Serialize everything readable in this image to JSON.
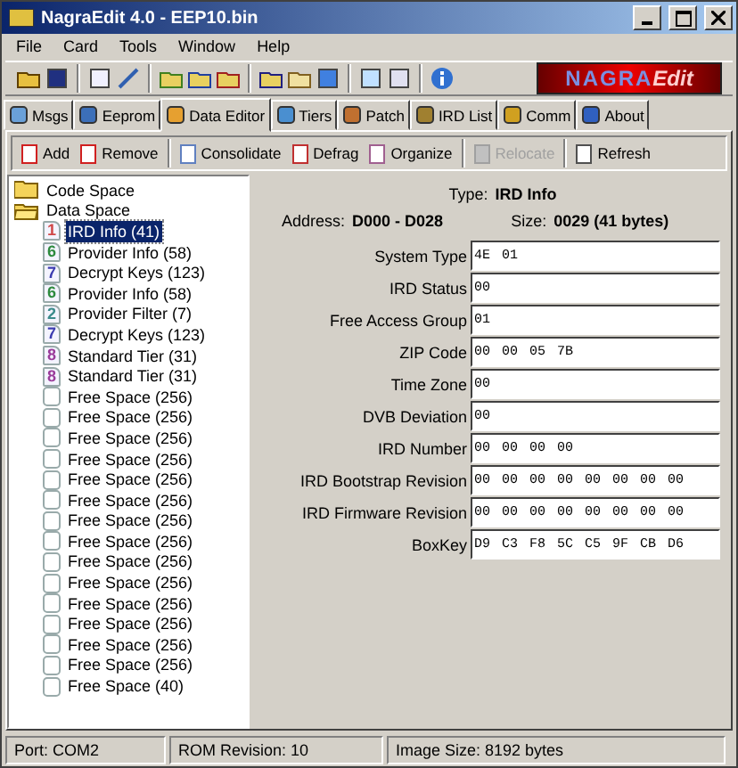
{
  "window": {
    "title": "NagraEdit 4.0 - EEP10.bin"
  },
  "menu": [
    "File",
    "Card",
    "Tools",
    "Window",
    "Help"
  ],
  "logo": {
    "main": "NAGRA",
    "accent": "Edit"
  },
  "tabs": [
    {
      "label": "Msgs",
      "selected": false
    },
    {
      "label": "Eeprom",
      "selected": false
    },
    {
      "label": "Data Editor",
      "selected": true
    },
    {
      "label": "Tiers",
      "selected": false
    },
    {
      "label": "Patch",
      "selected": false
    },
    {
      "label": "IRD List",
      "selected": false
    },
    {
      "label": "Comm",
      "selected": false
    },
    {
      "label": "About",
      "selected": false
    }
  ],
  "actions": [
    {
      "label": "Add",
      "disabled": false
    },
    {
      "label": "Remove",
      "disabled": false
    },
    {
      "label": "Consolidate",
      "disabled": false
    },
    {
      "label": "Defrag",
      "disabled": false
    },
    {
      "label": "Organize",
      "disabled": false
    },
    {
      "label": "Relocate",
      "disabled": true
    },
    {
      "label": "Refresh",
      "disabled": false
    }
  ],
  "tree": [
    {
      "label": "Code Space",
      "expanded": false
    },
    {
      "label": "Data Space",
      "expanded": true,
      "children": [
        {
          "label": "IRD Info (41)",
          "badge": "1",
          "color": "#d04848",
          "selected": true
        },
        {
          "label": "Provider Info (58)",
          "badge": "6",
          "color": "#2e8b3e",
          "selected": false
        },
        {
          "label": "Decrypt Keys (123)",
          "badge": "7",
          "color": "#3c3cb0",
          "selected": false
        },
        {
          "label": "Provider Info (58)",
          "badge": "6",
          "color": "#2e8b3e",
          "selected": false
        },
        {
          "label": "Provider Filter (7)",
          "badge": "2",
          "color": "#3c8c8c",
          "selected": false
        },
        {
          "label": "Decrypt Keys (123)",
          "badge": "7",
          "color": "#3c3cb0",
          "selected": false
        },
        {
          "label": "Standard Tier (31)",
          "badge": "8",
          "color": "#9a3c9a",
          "selected": false
        },
        {
          "label": "Standard Tier (31)",
          "badge": "8",
          "color": "#9a3c9a",
          "selected": false
        },
        {
          "label": "Free Space (256)",
          "selected": false
        },
        {
          "label": "Free Space (256)",
          "selected": false
        },
        {
          "label": "Free Space (256)",
          "selected": false
        },
        {
          "label": "Free Space (256)",
          "selected": false
        },
        {
          "label": "Free Space (256)",
          "selected": false
        },
        {
          "label": "Free Space (256)",
          "selected": false
        },
        {
          "label": "Free Space (256)",
          "selected": false
        },
        {
          "label": "Free Space (256)",
          "selected": false
        },
        {
          "label": "Free Space (256)",
          "selected": false
        },
        {
          "label": "Free Space (256)",
          "selected": false
        },
        {
          "label": "Free Space (256)",
          "selected": false
        },
        {
          "label": "Free Space (256)",
          "selected": false
        },
        {
          "label": "Free Space (256)",
          "selected": false
        },
        {
          "label": "Free Space (256)",
          "selected": false
        },
        {
          "label": "Free Space (40)",
          "selected": false
        }
      ]
    }
  ],
  "record": {
    "type_label": "Type:",
    "type": "IRD Info",
    "address_label": "Address:",
    "address": "D000 - D028",
    "size_label": "Size:",
    "size": "0029 (41 bytes)"
  },
  "fields": [
    {
      "label": "System Type",
      "value": "4E 01"
    },
    {
      "label": "IRD Status",
      "value": "00"
    },
    {
      "label": "Free Access Group",
      "value": "01"
    },
    {
      "label": "ZIP Code",
      "value": "00 00 05 7B"
    },
    {
      "label": "Time Zone",
      "value": "00"
    },
    {
      "label": "DVB Deviation",
      "value": "00"
    },
    {
      "label": "IRD Number",
      "value": "00 00 00 00"
    },
    {
      "label": "IRD Bootstrap Revision",
      "value": "00 00 00 00 00 00 00 00"
    },
    {
      "label": "IRD Firmware Revision",
      "value": "00 00 00 00 00 00 00 00"
    },
    {
      "label": "BoxKey",
      "value": "D9 C3 F8 5C C5 9F CB D6"
    }
  ],
  "status_bar": [
    "Port: COM2",
    "ROM Revision: 10",
    "Image Size: 8192 bytes"
  ]
}
